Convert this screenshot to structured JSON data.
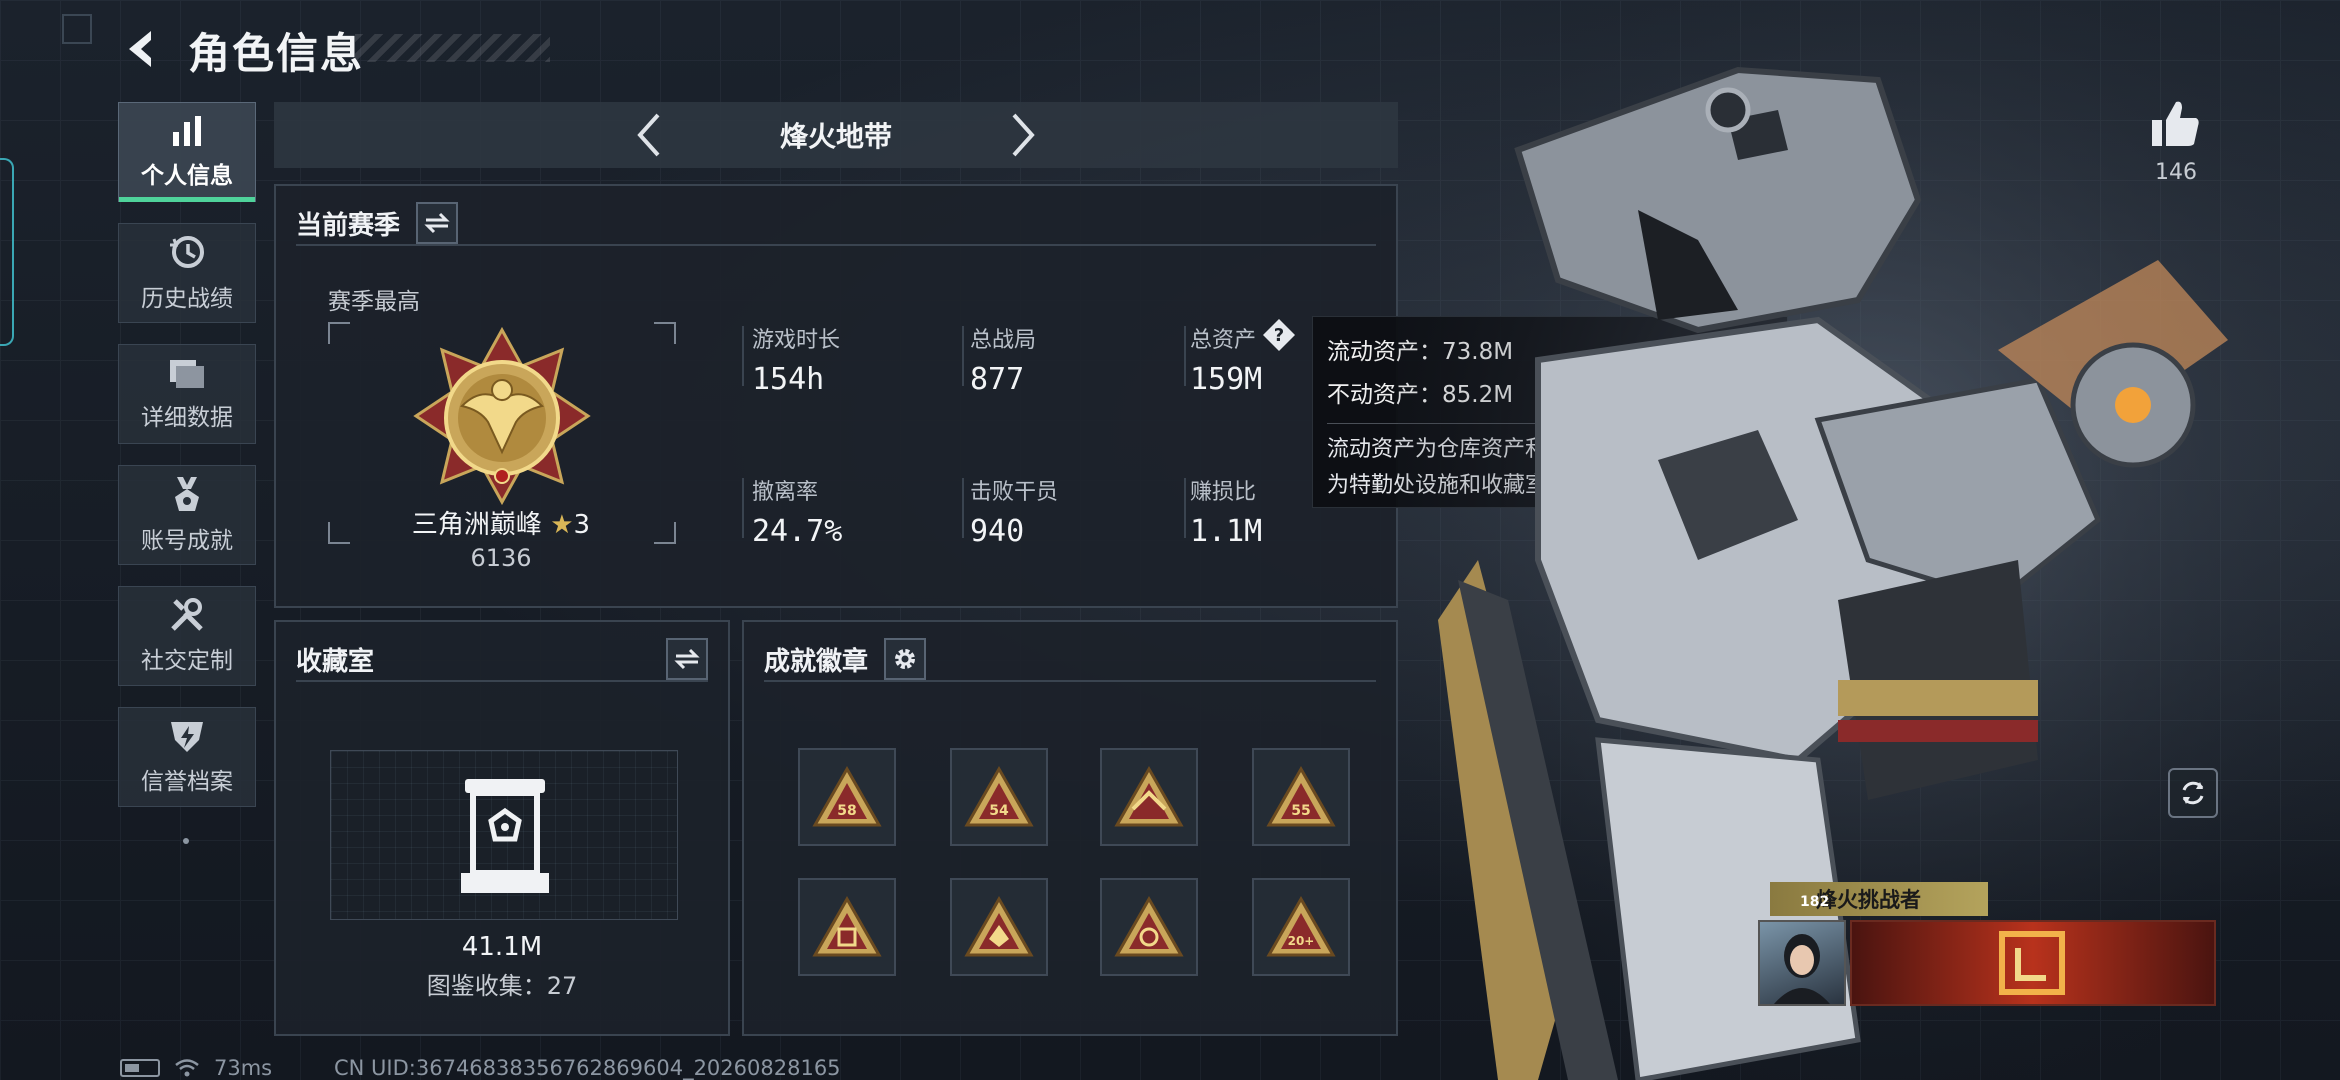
{
  "header": {
    "title": "角色信息"
  },
  "sidebar": {
    "items": [
      {
        "label": "个人信息",
        "icon": "bar-chart-icon",
        "active": true
      },
      {
        "label": "历史战绩",
        "icon": "history-clock-icon",
        "active": false
      },
      {
        "label": "详细数据",
        "icon": "folder-icon",
        "active": false
      },
      {
        "label": "账号成就",
        "icon": "medal-icon",
        "active": false
      },
      {
        "label": "社交定制",
        "icon": "tools-icon",
        "active": false
      },
      {
        "label": "信誉档案",
        "icon": "shield-bolt-icon",
        "active": false
      }
    ]
  },
  "mode": {
    "title": "烽火地带"
  },
  "season": {
    "panel_title": "当前赛季",
    "best_label": "赛季最高",
    "rank_name": "三角洲巅峰",
    "rank_stars": "3",
    "rank_score": "6136"
  },
  "stats": {
    "play_time": {
      "label": "游戏时长",
      "value": "154h"
    },
    "total_matches": {
      "label": "总战局",
      "value": "877"
    },
    "total_assets": {
      "label": "总资产",
      "value": "159M"
    },
    "extract_rate": {
      "label": "撤离率",
      "value": "24.7%"
    },
    "kills": {
      "label": "击败干员",
      "value": "940"
    },
    "profit_ratio": {
      "label": "赚损比",
      "value": "1.1M"
    }
  },
  "tooltip": {
    "liquid": "流动资产：73.8M",
    "fixed": "不动资产：85.2M",
    "desc_line1": "流动资产为仓库资产和哈夫币，不动资产",
    "desc_line2": "为特勤处设施和收藏室设施"
  },
  "collection": {
    "panel_title": "收藏室",
    "value": "41.1M",
    "count": "图鉴收集：27"
  },
  "badges": {
    "panel_title": "成就徽章",
    "items": [
      "58",
      "54",
      "",
      "55",
      "",
      "",
      "",
      "20+"
    ]
  },
  "right": {
    "likes": "146",
    "player_title": "烽火挑战者",
    "player_level": "182"
  },
  "status": {
    "ping": "73ms",
    "uid": "CN UID:36746838356762869604_20260828165"
  },
  "colors": {
    "accent_green": "#4fd39b",
    "gold": "#c9a65a",
    "panel_bg": "#1c222a"
  }
}
